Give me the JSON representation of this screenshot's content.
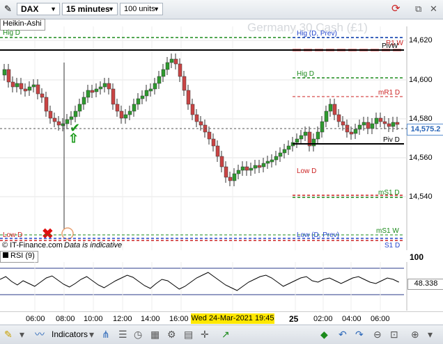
{
  "toolbar": {
    "market": "DAX",
    "timeframe": "15 minutes",
    "units": "100 units",
    "menu_icon": "pencil-icon",
    "refresh_icon": "refresh-icon",
    "window_icons": [
      "restore-icon",
      "close-icon"
    ]
  },
  "chart": {
    "title": "Germany 30 Cash (£1)",
    "indicator": "Heikin-Ashi",
    "current_price": "14,575.2",
    "price_ticks": [
      "14,620",
      "14,600",
      "14,580",
      "14,560",
      "14,540"
    ],
    "copyright": "© IT-Finance.com",
    "disclaimer": "Data is indicative",
    "levels": [
      {
        "label": "Hig D",
        "side": "left",
        "color": "#1a8a1a"
      },
      {
        "label": "Hig (D, Prev)",
        "side": "mid",
        "color": "#2244cc"
      },
      {
        "label": "R1 W",
        "side": "right",
        "color": "#cc2222"
      },
      {
        "label": "PivW",
        "side": "right",
        "color": "#000000"
      },
      {
        "label": "Hig D",
        "side": "mid",
        "color": "#1a8a1a"
      },
      {
        "label": "mR1 D",
        "side": "right",
        "color": "#cc2222"
      },
      {
        "label": "Piv D",
        "side": "right",
        "color": "#000000"
      },
      {
        "label": "Low D",
        "side": "mid",
        "color": "#cc2222"
      },
      {
        "label": "mS1 D",
        "side": "right",
        "color": "#1a8a1a"
      },
      {
        "label": "Low D",
        "side": "left",
        "color": "#cc2222"
      },
      {
        "label": "mS1 W",
        "side": "right",
        "color": "#1a8a1a"
      },
      {
        "label": "Low (D, Prev)",
        "side": "mid",
        "color": "#2244cc"
      },
      {
        "label": "S1 D",
        "side": "right",
        "color": "#2244cc"
      }
    ]
  },
  "rsi": {
    "label": "RSI (9)",
    "top_value": "100",
    "current_value": "48.338"
  },
  "time_axis": {
    "ticks": [
      "06:00",
      "08:00",
      "10:00",
      "12:00",
      "14:00",
      "16:00",
      "25",
      "02:00",
      "04:00",
      "06:00"
    ],
    "crosshair_date": "Wed 24-Mar-2021 19:45"
  },
  "bottom_bar": {
    "indicators_label": "Indicators",
    "icons": [
      "draw-icon",
      "indicators-icon",
      "share-icon",
      "list-icon",
      "clock-icon",
      "calendar-icon",
      "settings-icon",
      "layout-icon",
      "crosshair-icon",
      "trend-icon",
      "undo-icon",
      "redo-icon",
      "zoom-out-icon",
      "zoom-fit-icon",
      "zoom-in-icon",
      "menu-icon"
    ]
  }
}
